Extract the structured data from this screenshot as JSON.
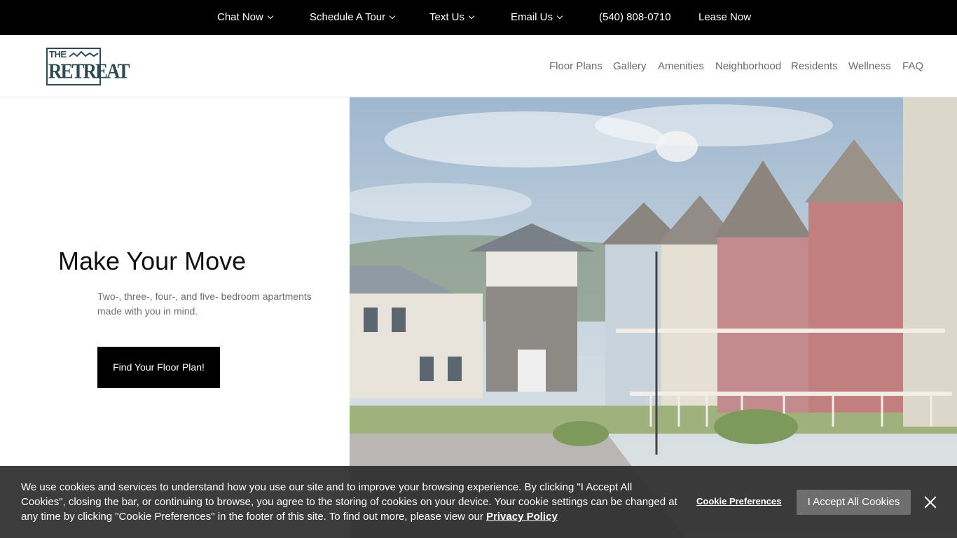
{
  "topbar": {
    "items": [
      {
        "label": "Chat Now",
        "dropdown": true
      },
      {
        "label": "Schedule A Tour",
        "dropdown": true
      },
      {
        "label": "Text Us",
        "dropdown": true
      },
      {
        "label": "Email Us",
        "dropdown": true
      },
      {
        "label": "(540) 808-0710",
        "dropdown": false
      },
      {
        "label": "Lease Now",
        "dropdown": false
      }
    ]
  },
  "header": {
    "logo": {
      "line1": "THE",
      "line2": "RETREAT"
    },
    "nav": [
      "Floor Plans",
      "Gallery",
      "Amenities",
      "Neighborhood",
      "Residents",
      "Wellness",
      "FAQ"
    ]
  },
  "hero": {
    "title": "Make Your Move",
    "subtitle": "Two-, three-, four-, and five- bedroom apartments made with you in mind.",
    "cta_label": "Find Your Floor Plan!"
  },
  "cookie": {
    "text": "We use cookies and services to understand how you use our site and to improve your browsing experience. By clicking \"I Accept All Cookies\", closing the bar, or continuing to browse, you agree to the storing of cookies on your device. Your cookie settings can be changed at any time by clicking \"Cookie Preferences\" in the footer of this site. To find out more, please view our",
    "privacy_link": "Privacy Policy",
    "preferences_label": "Cookie Preferences",
    "accept_label": "I Accept All Cookies"
  },
  "colors": {
    "topbar_bg": "#000000",
    "logo": "#2f4a55",
    "nav_text": "#6b6b6b",
    "cta_bg": "#000000",
    "cookie_bg": "#2d2d2d",
    "accept_bg": "#6e6e6e"
  }
}
